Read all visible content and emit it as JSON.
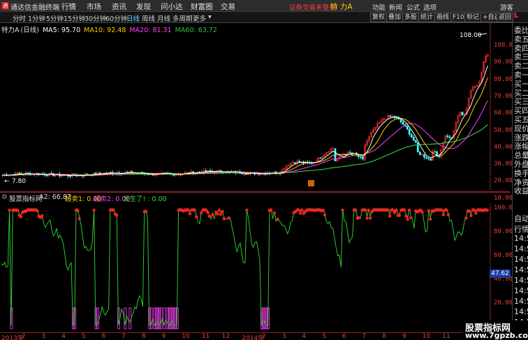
{
  "app": {
    "title": "通达信金融终端",
    "menu": [
      "行情",
      "市场",
      "资讯",
      "发现",
      "问小达",
      "财富圈",
      "交易"
    ],
    "status_text": "证券交易未登录",
    "stock_label": "特 力A",
    "right_menu": [
      "功能",
      "新闻",
      "公式",
      "选项"
    ],
    "guest": "游客",
    "logo": "通"
  },
  "toolbar": {
    "periods": [
      "分时",
      "1分钟",
      "5分钟",
      "15分钟",
      "30分钟",
      "60分钟",
      "日线",
      "周线",
      "月线",
      "多周期",
      "更多"
    ],
    "active_period": "日线",
    "buttons": [
      "复权",
      "叠加",
      "多股",
      "统计",
      "画线",
      "F10",
      "标记",
      "+自选",
      "返回"
    ]
  },
  "chart_info": {
    "name": "特力A",
    "period": "(日线)",
    "ma5": "MA5: 95.70",
    "ma10": "MA10: 92.48",
    "ma20": "MA20: 81.31",
    "ma60": "MA60: 63.72"
  },
  "colors": {
    "ma5": "#ffffff",
    "ma10": "#ffcc00",
    "ma20": "#ff40ff",
    "ma60": "#30c040",
    "up": "#ff3030",
    "down": "#40ffff",
    "indicator": "#2ec42e",
    "signal": "#ff2020"
  },
  "price_axis": [
    "100.0",
    "90.00",
    "80.00",
    "70.00",
    "60.00",
    "50.00",
    "40.00",
    "30.00",
    "20.00",
    "10.00"
  ],
  "price_annotations": {
    "high": "108.00",
    "low": "7.80"
  },
  "indicator": {
    "name": "股票指标网",
    "a2": "A2: 66.87",
    "buy1": "超卖1: 0.00",
    "buy2": "超卖2: 0.00",
    "signal": "发生了!  : 0.00",
    "axis": [
      "100.0",
      "80.00",
      "60.00",
      "40.00",
      "20.00"
    ],
    "current_value": "47.62"
  },
  "dates": [
    "2013年",
    "2",
    "3",
    "4",
    "5",
    "6",
    "7",
    "8",
    "9",
    "10",
    "11",
    "12",
    "2014年",
    "2",
    "3",
    "4",
    "5",
    "6",
    "7",
    "8",
    "9",
    "10",
    "11"
  ],
  "right_panel": {
    "l_mark": "L",
    "top_items": [
      "委比",
      "卖五",
      "卖四",
      "卖三",
      "卖二",
      "卖一",
      "买一",
      "买二",
      "买三",
      "买四",
      "买五",
      "现价",
      "涨跌",
      "涨幅",
      "总量",
      "外盘",
      "换手",
      "净资",
      "收益"
    ],
    "bottom_items": [
      "自动",
      "行情",
      "14:5",
      "14:5",
      "14:5",
      "14:5",
      "14:5",
      "14:5",
      "14:5",
      "14:5",
      "14:5"
    ]
  },
  "watermark": {
    "title": "股票指标网",
    "url": "www.7gpzb.com"
  }
}
